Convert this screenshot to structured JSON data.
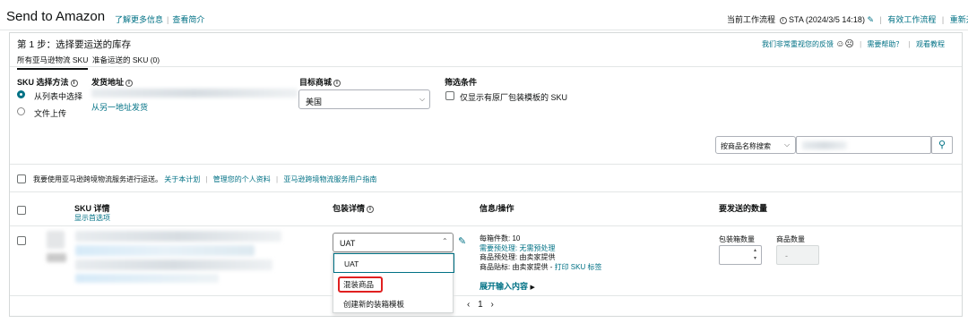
{
  "header": {
    "title": "Send to Amazon",
    "learn_more": "了解更多信息",
    "view_intro": "查看简介",
    "current_workflow_label": "当前工作流程",
    "current_workflow_value": "STA (2024/3/5 14:18)",
    "active_workflows": "有效工作流程",
    "restart": "重新开始"
  },
  "step": {
    "title": "第 1 步：选择要运送的库存",
    "feedback": "我们非常重视您的反馈",
    "need_help": "需要帮助？",
    "watch_tutorial": "观看教程",
    "tabs": [
      "所有亚马逊物流 SKU",
      "准备运送的 SKU (0)"
    ]
  },
  "sku_method": {
    "label": "SKU 选择方法",
    "options": [
      "从列表中选择",
      "文件上传"
    ]
  },
  "ship_from": {
    "label": "发货地址",
    "link": "从另一地址发货"
  },
  "marketplace": {
    "label": "目标商城",
    "value": "美国"
  },
  "filter": {
    "label": "筛选条件",
    "checkbox_label": "仅显示有原厂包装模板的 SKU"
  },
  "search": {
    "select_value": "按商品名称搜索"
  },
  "program": {
    "checkbox_label": "我要使用亚马逊跨境物流服务进行运送。",
    "about_link": "关于本计划",
    "manage_link": "管理您的个人资料",
    "guide_link": "亚马逊跨境物流服务用户指南"
  },
  "table": {
    "col_sku": "SKU 详情",
    "show_preferred": "显示首选项",
    "col_packing": "包装详情",
    "col_info": "信息/操作",
    "col_qty": "要发送的数量"
  },
  "row": {
    "packing_value": "UAT",
    "units_per_box": "每箱件数: 10",
    "prep_required_label": "需要预处理:",
    "prep_required_value": "无需预处理",
    "prep_label": "商品预处理:",
    "prep_value": "由卖家提供",
    "label_line_label": "商品贴标:",
    "label_line_value": "由卖家提供",
    "print_sku": "打印 SKU 标签",
    "expand": "展开输入内容",
    "box_qty_label": "包装箱数量",
    "unit_qty_label": "商品数量",
    "unit_qty_placeholder": "-"
  },
  "dropdown": {
    "options": [
      "UAT",
      "混装商品",
      "创建新的装箱模板"
    ]
  },
  "pagination": {
    "page": "1"
  },
  "colors": {
    "link": "#007185",
    "highlight": "#e02020",
    "focus": "#007185"
  }
}
